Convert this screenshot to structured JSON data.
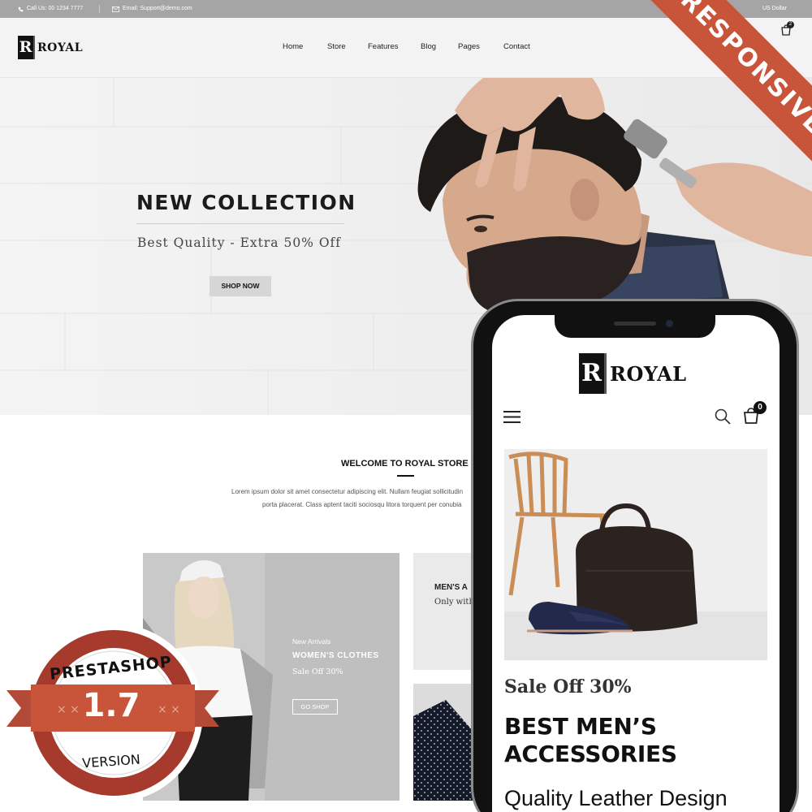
{
  "topbar": {
    "phone": "Call Us: 00 1234 7777",
    "email": "Email: Support@demo.com",
    "currency": "US Dollar"
  },
  "header": {
    "logo_mark": "R",
    "logo_text": "ROYAL",
    "nav": [
      "Home",
      "Store",
      "Features",
      "Blog",
      "Pages",
      "Contact"
    ],
    "cart_count": "2"
  },
  "hero": {
    "title": "NEW COLLECTION",
    "subtitle": "Best Quality -  Extra 50% Off",
    "button": "SHOP NOW"
  },
  "welcome": {
    "title": "WELCOME TO ROYAL STORE",
    "line1": "Lorem ipsum dolor sit amet consectetur adipiscing elit. Nullam feugiat sollicitudin",
    "line2": "porta placerat. Class aptent taciti sociosqu litora torquent per conubia"
  },
  "banners": {
    "women": {
      "small": "New Arrivals",
      "title": "WOMEN'S CLOTHES",
      "sale": "Sale Off 30%",
      "button": "GO SHOP"
    },
    "men": {
      "title": "MEN'S A",
      "subtitle": "Only with"
    }
  },
  "ribbon": "RESPONSIVE",
  "mobile": {
    "logo_mark": "R",
    "logo_text": "ROYAL",
    "cart_count": "0",
    "sale": "Sale Off 30%",
    "title_line1": "BEST MEN’S",
    "title_line2": "ACCESSORIES",
    "subtitle": "Quality Leather Design"
  },
  "badge": {
    "brand": "PRESTASHOP",
    "version_number": "1.7",
    "version_label": "VERSION"
  },
  "colors": {
    "accent": "#c8553a",
    "topbar": "#a5a5a5",
    "dark": "#111111"
  }
}
